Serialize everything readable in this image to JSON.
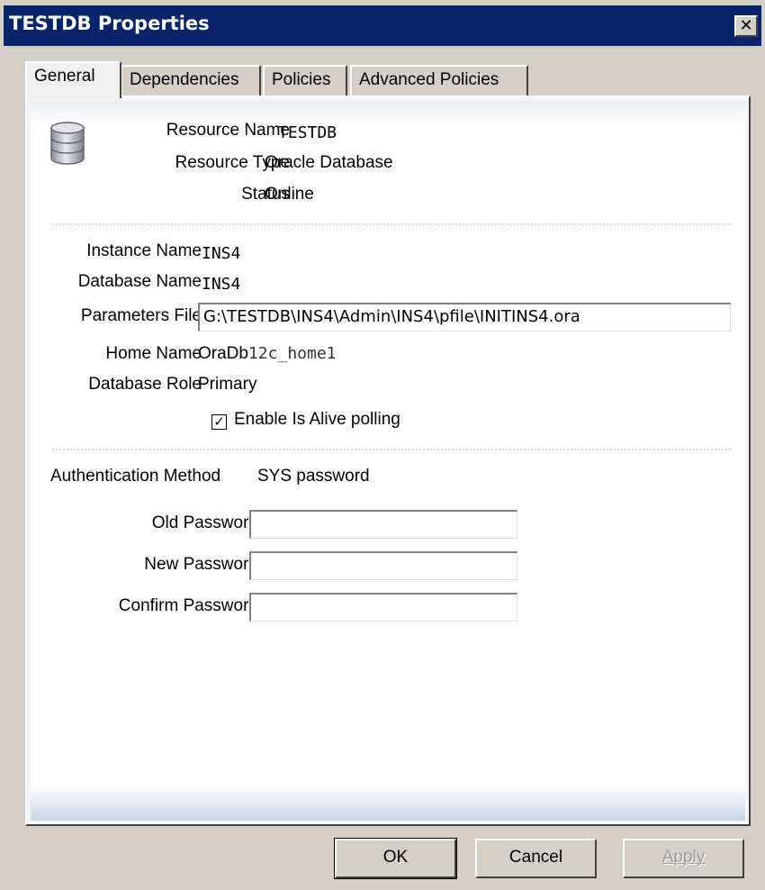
{
  "window": {
    "title": "TESTDB Properties",
    "close_glyph": "✕",
    "colors": {
      "titlebar": "#0a246a",
      "face": "#d4d0c8"
    }
  },
  "tabs": [
    {
      "label": "General",
      "active": true
    },
    {
      "label": "Dependencies",
      "active": false
    },
    {
      "label": "Policies",
      "active": false
    },
    {
      "label": "Advanced Policies",
      "active": false
    }
  ],
  "resource": {
    "icon": "database-icon",
    "name_label": "Resource Name",
    "name_value": "TESTDB",
    "type_label": "Resource Type",
    "type_value": "Oracle Database",
    "status_label": "Status",
    "status_value": "Online"
  },
  "instance": {
    "instance_label": "Instance Name",
    "instance_value": "INS4",
    "database_label": "Database Name",
    "database_value": "INS4",
    "params_label": "Parameters File",
    "params_value": "G:\\TESTDB\\INS4\\Admin\\INS4\\pfile\\INITINS4.ora",
    "home_label": "Home Name",
    "home_value_a": "OraDb",
    "home_value_b": "12c_home1",
    "role_label": "Database Role",
    "role_value": "Primary",
    "polling_label": "Enable Is Alive polling",
    "polling_checked": true
  },
  "auth": {
    "method_label": "Authentication Method",
    "method_value": "SYS password",
    "old_label": "Old Password",
    "old_value": "",
    "new_label": "New Password",
    "new_value": "",
    "confirm_label": "Confirm Password",
    "confirm_value": ""
  },
  "buttons": {
    "ok": "OK",
    "cancel": "Cancel",
    "apply": "Apply",
    "apply_enabled": false
  }
}
